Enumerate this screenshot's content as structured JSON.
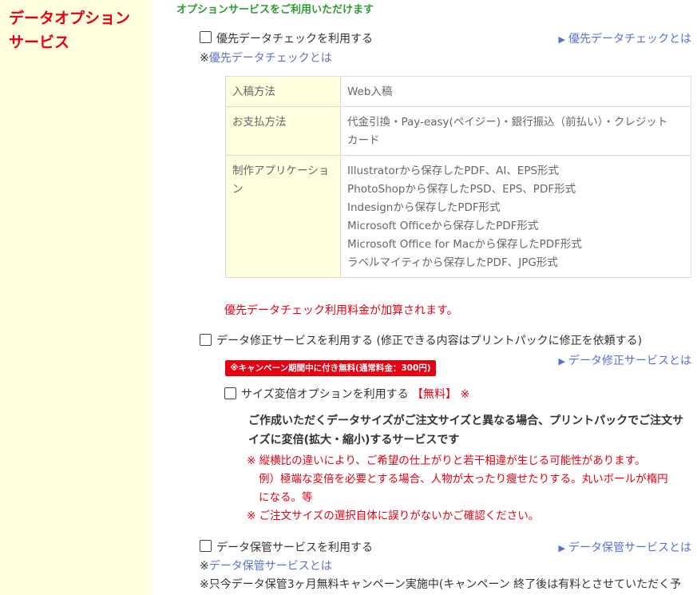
{
  "sidebar": {
    "title_line1": "データオプション",
    "title_line2": "サービス"
  },
  "main": {
    "intro": "オプションサービスをご利用いただけます",
    "priority_check": {
      "checkbox_label": "優先データチェックを利用する",
      "link_label": "優先データチェックとは",
      "note_prefix": "※",
      "note_link": "優先データチェックとは",
      "table": [
        {
          "header": "入稿方法",
          "values": [
            "Web入稿"
          ]
        },
        {
          "header": "お支払方法",
          "values": [
            "代金引換・Pay-easy(ペイジー)・銀行振込（前払い）・クレジット",
            "カード"
          ]
        },
        {
          "header_lines": [
            "制作アプリケーショ",
            "ン"
          ],
          "values": [
            "Illustratorから保存したPDF、AI、EPS形式",
            "PhotoShopから保存したPSD、EPS、PDF形式",
            "Indesignから保存したPDF形式",
            "Microsoft Officeから保存したPDF形式",
            "Microsoft Office for Macから保存したPDF形式",
            "ラベルマイティから保存したPDF、JPG形式"
          ]
        }
      ],
      "fee_note": "優先データチェック利用料金が加算されます。"
    },
    "data_fix": {
      "checkbox_label": "データ修正サービスを利用する (修正できる内容はプリントパックに修正を依頼する)",
      "link_label": "データ修正サービスとは",
      "campaign_badge": "※キャンペーン期間中に付き無料(通常料金：300円)",
      "size_option": {
        "checkbox_label": "サイズ変倍オプションを利用する",
        "free_tag": "【無料】",
        "mark": "※",
        "description_line1": "ご作成いただくデータサイズがご注文サイズと異なる場合、プリントパックでご注文サ",
        "description_line2": "イズに変倍(拡大・縮小)するサービスです",
        "warning1_line1": "※ 縦横比の違いにより、ご希望の仕上がりと若干相違が生じる可能性があります。",
        "warning1_line2": "例）極端な変倍を必要とする場合、人物が太ったり瘦せたりする。丸いボールが楕円",
        "warning1_line3": "になる。等",
        "warning2": "※ ご注文サイズの選択自体に誤りがないかご確認ください。"
      }
    },
    "data_storage": {
      "checkbox_label": "データ保管サービスを利用する",
      "link_label": "データ保管サービスとは",
      "note_prefix": "※",
      "note_link": "データ保管サービスとは",
      "campaign_text": "※只今データ保管3ヶ月無料キャンペーン実施中(キャンペーン 終了後は有料とさせていただく予"
    }
  },
  "icons": {
    "link_marker": "triangle-right-icon"
  },
  "colors": {
    "accent_red": "#e60012",
    "intro_green": "#2e9b2e",
    "link_blue": "#5a6fd6",
    "sidebar_bg": "#ffffe0"
  }
}
